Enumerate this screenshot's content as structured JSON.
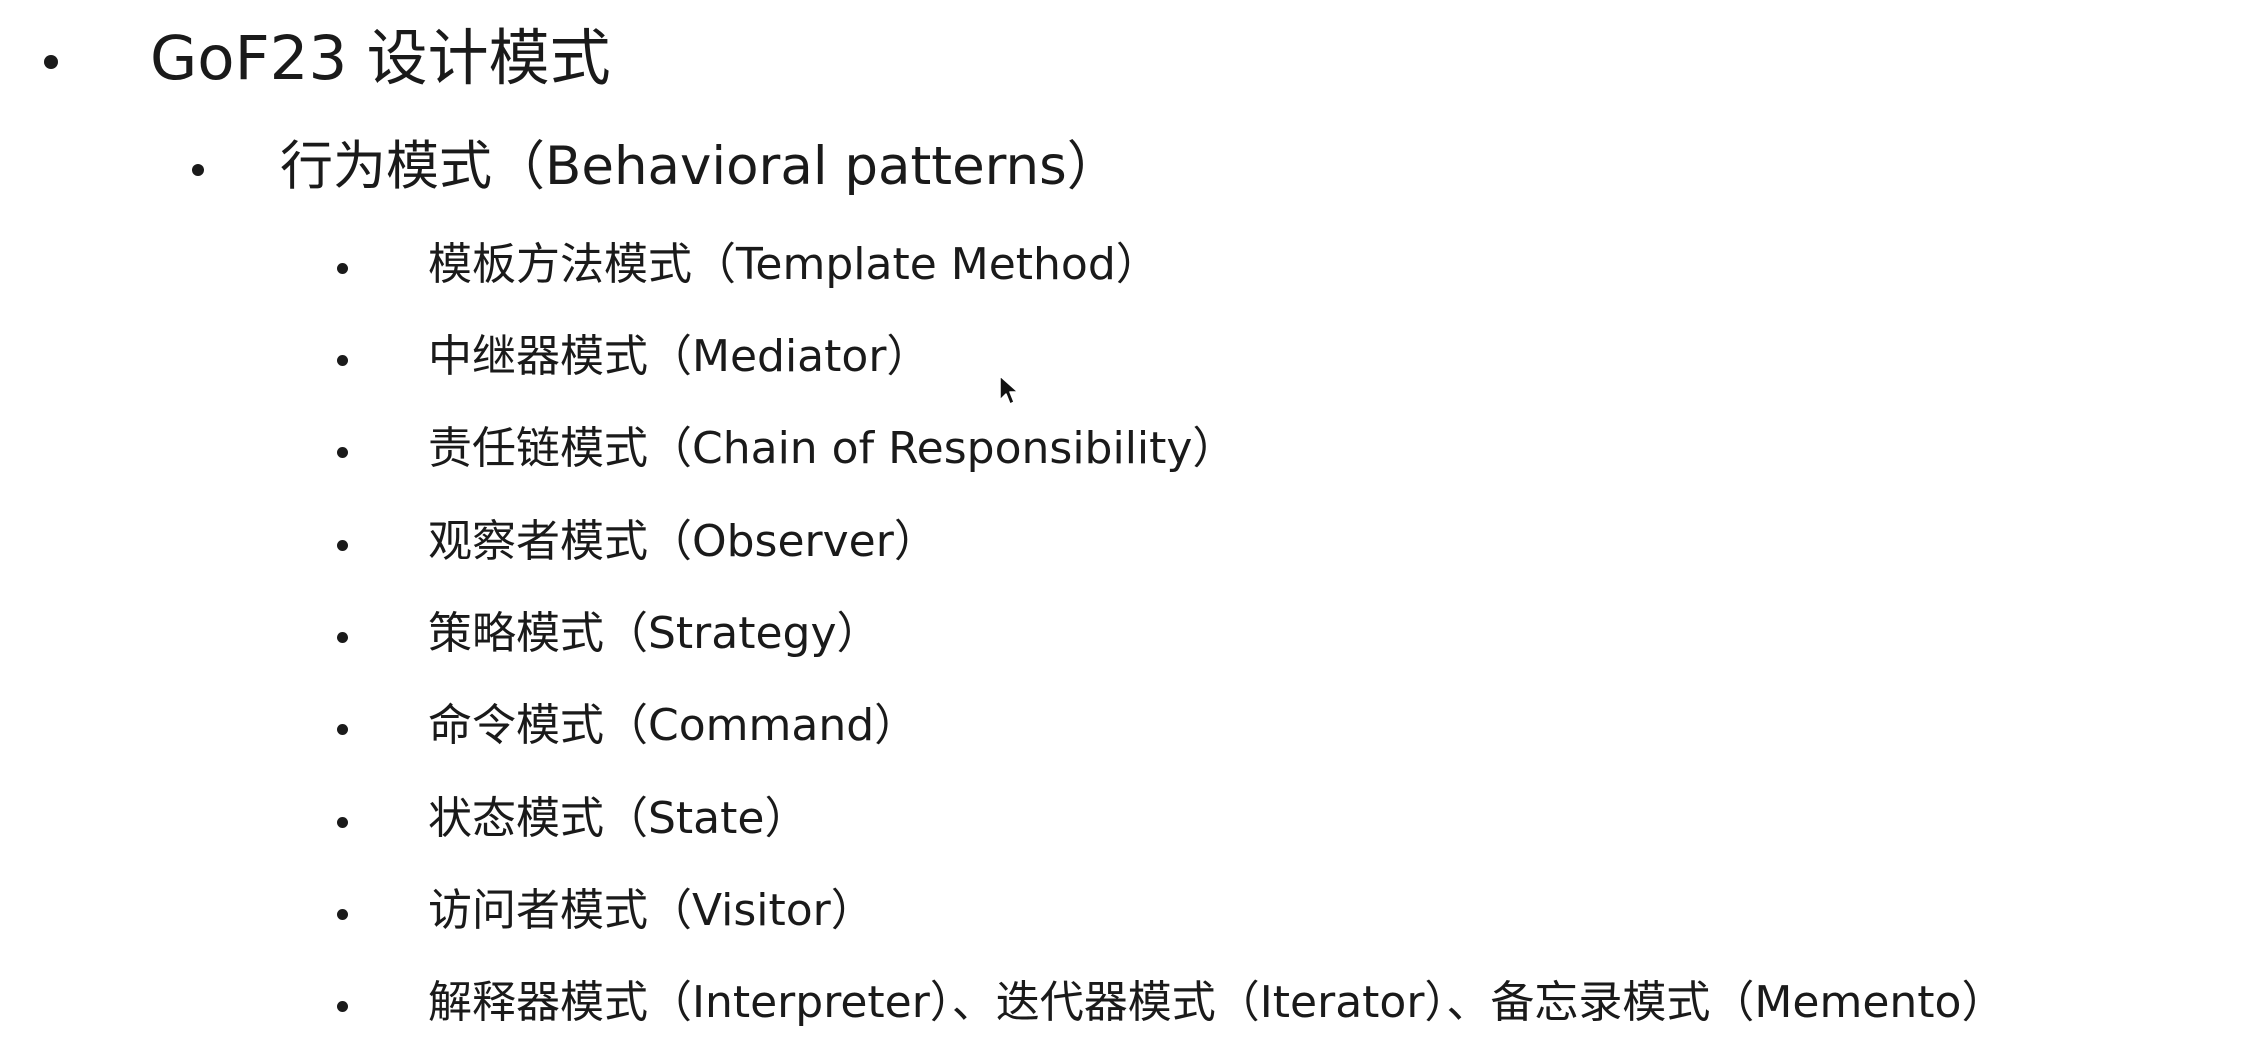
{
  "heading": "GoF23 设计模式",
  "subheading": "行为模式（Behavioral patterns）",
  "patterns": [
    "模板方法模式（Template Method）",
    "中继器模式（Mediator）",
    "责任链模式（Chain of Responsibility）",
    "观察者模式（Observer）",
    "策略模式（Strategy）",
    "命令模式（Command）",
    "状态模式（State）",
    "访问者模式（Visitor）",
    "解释器模式（Interpreter）、迭代器模式（Iterator）、备忘录模式（Memento）"
  ],
  "icons": {
    "bullet": "bullet-dot-icon",
    "cursor": "mouse-pointer-icon"
  }
}
